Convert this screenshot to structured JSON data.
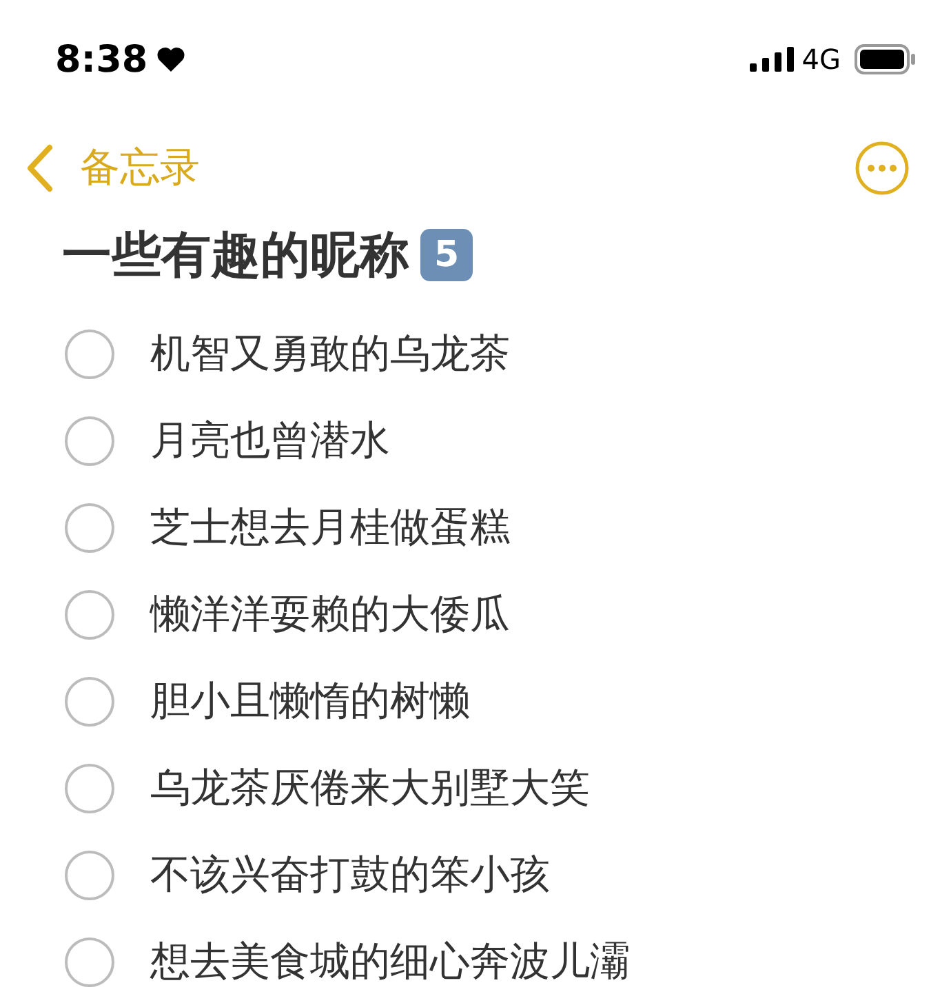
{
  "status_bar": {
    "time": "8:38",
    "network": "4G"
  },
  "nav": {
    "back_label": "备忘录"
  },
  "note": {
    "title": "一些有趣的昵称",
    "title_badge": "5"
  },
  "checklist": [
    {
      "text": "机智又勇敢的乌龙茶",
      "checked": false
    },
    {
      "text": "月亮也曾潜水",
      "checked": false
    },
    {
      "text": "芝士想去月桂做蛋糕",
      "checked": false
    },
    {
      "text": "懒洋洋耍赖的大倭瓜",
      "checked": false
    },
    {
      "text": "胆小且懒惰的树懒",
      "checked": false
    },
    {
      "text": "乌龙茶厌倦来大别墅大笑",
      "checked": false
    },
    {
      "text": "不该兴奋打鼓的笨小孩",
      "checked": false
    },
    {
      "text": "想去美食城的细心奔波儿灞",
      "checked": false
    }
  ]
}
